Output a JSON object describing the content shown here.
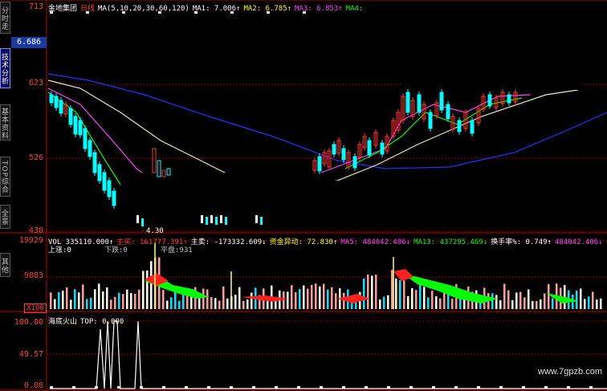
{
  "sidebar": {
    "tabs": [
      {
        "label": "分时走势",
        "active": false
      },
      {
        "label": "技术分析",
        "active": true
      },
      {
        "label": "基本资料",
        "active": false
      },
      {
        "label": "TOP综合",
        "active": false
      },
      {
        "label": "全景",
        "active": false
      },
      {
        "label": "其他",
        "active": false
      }
    ]
  },
  "price_panel": {
    "stock_name": "金地集团",
    "period": "日线",
    "ma_params": "MA(5,10,20,30,60,120)",
    "ma1": "MA1: 7.006↑",
    "ma2": "MA2: 6.785↑",
    "ma3": "MA3: 6.853↑",
    "ma4": "MA4:",
    "axis": {
      "top": "713",
      "cursor": "6.686",
      "l623": "623",
      "l526": "526",
      "l430": "430"
    },
    "low_label": "4.30"
  },
  "volume_panel": {
    "vol": "VOL 335110.000↑",
    "main_buy": "主买: 161777.391↑",
    "main": "主卖: -173332.609↓",
    "fund": "资金异动: 72.830↑",
    "ma5": "MA5: 484042.406↓",
    "ma13": "MA13: 437295.469↓",
    "turnover": "换手率%: 0.749↑",
    "extra": "484042.406↓",
    "extra2": "484042",
    "up": "上涨:0",
    "down": "下跌:0",
    "flat": "平盘:931",
    "axis": {
      "top": "19929",
      "mid": "9883",
      "unit": "X100"
    }
  },
  "indicator_panel": {
    "name": "海底火山",
    "top": "TOP: 0.000",
    "axis": {
      "top": "100.00",
      "mid": "49.57",
      "bottom": "0.00"
    }
  },
  "watermark": "www.7gpzb.com",
  "colors": {
    "up": "#ff3232",
    "down": "#00ffff",
    "grid": "#8b0000",
    "ma_blue": "#2c2cff"
  }
}
